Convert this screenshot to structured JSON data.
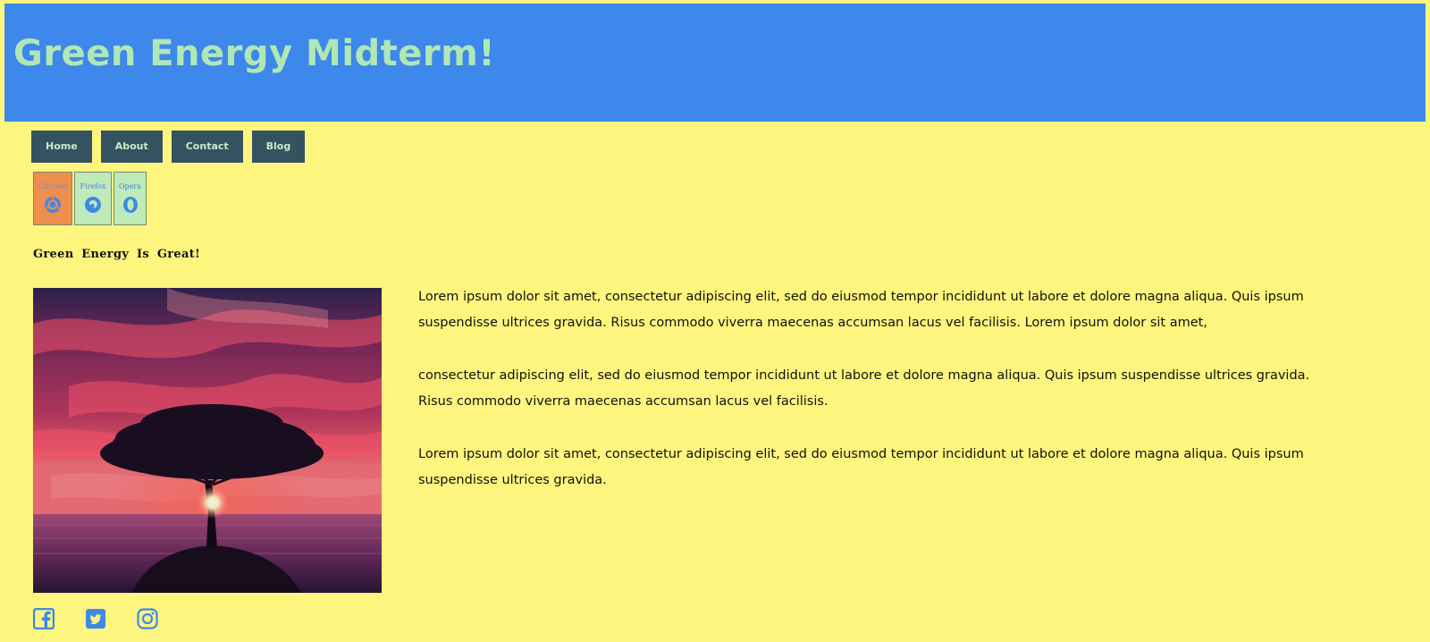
{
  "header": {
    "title": "Green Energy Midterm!"
  },
  "nav": {
    "items": [
      {
        "label": "Home"
      },
      {
        "label": "About"
      },
      {
        "label": "Contact"
      },
      {
        "label": "Blog"
      }
    ]
  },
  "browsers": [
    {
      "label": "Chrome",
      "icon": "chrome-icon"
    },
    {
      "label": "Firefox",
      "icon": "firefox-icon"
    },
    {
      "label": "Opera",
      "icon": "opera-icon"
    }
  ],
  "main": {
    "subtitle": "Green Energy Is Great!",
    "paragraphs": [
      "Lorem ipsum dolor sit amet, consectetur adipiscing elit, sed do eiusmod tempor incididunt ut labore et dolore magna aliqua. Quis ipsum suspendisse ultrices gravida. Risus commodo viverra maecenas accumsan lacus vel facilisis. Lorem ipsum dolor sit amet,",
      "consectetur adipiscing elit, sed do eiusmod tempor incididunt ut labore et dolore magna aliqua. Quis ipsum suspendisse ultrices gravida. Risus commodo viverra maecenas accumsan lacus vel facilisis.",
      "Lorem ipsum dolor sit amet, consectetur adipiscing elit, sed do eiusmod tempor incididunt ut labore et dolore magna aliqua. Quis ipsum suspendisse ultrices gravida."
    ],
    "hero_image": "tree-sunset-image"
  },
  "social": [
    {
      "icon": "facebook-icon"
    },
    {
      "icon": "twitter-icon"
    },
    {
      "icon": "instagram-icon"
    }
  ],
  "colors": {
    "page_background": "#fef57e",
    "header_background": "#3d88ea",
    "title_color": "#b0e7b5",
    "nav_background": "#355262",
    "nav_text": "#c6ecc8",
    "chrome_card": "#ee8f4d",
    "browser_card": "#bfeab9",
    "icon_blue": "#3d88ea"
  }
}
